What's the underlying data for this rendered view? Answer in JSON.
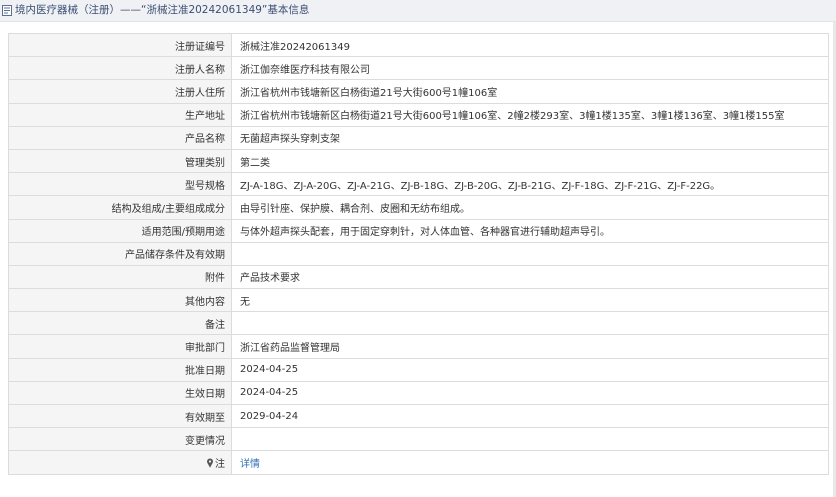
{
  "header": {
    "icon": "document-icon",
    "title": "境内医疗器械（注册）——“浙械注准20242061349”基本信息"
  },
  "rows": [
    {
      "label": "注册证编号",
      "value": "浙械注准20242061349"
    },
    {
      "label": "注册人名称",
      "value": "浙江伽奈维医疗科技有限公司"
    },
    {
      "label": "注册人住所",
      "value": "浙江省杭州市钱塘新区白杨街道21号大街600号1幢106室"
    },
    {
      "label": "生产地址",
      "value": "浙江省杭州市钱塘新区白杨街道21号大街600号1幢106室、2幢2楼293室、3幢1楼135室、3幢1楼136室、3幢1楼155室"
    },
    {
      "label": "产品名称",
      "value": "无菌超声探头穿刺支架"
    },
    {
      "label": "管理类别",
      "value": "第二类"
    },
    {
      "label": "型号规格",
      "value": "ZJ-A-18G、ZJ-A-20G、ZJ-A-21G、ZJ-B-18G、ZJ-B-20G、ZJ-B-21G、ZJ-F-18G、ZJ-F-21G、ZJ-F-22G。"
    },
    {
      "label": "结构及组成/主要组成成分",
      "value": "由导引针座、保护膜、耦合剂、皮圈和无纺布组成。"
    },
    {
      "label": "适用范围/预期用途",
      "value": "与体外超声探头配套，用于固定穿刺针，对人体血管、各种器官进行辅助超声导引。"
    },
    {
      "label": "产品储存条件及有效期",
      "value": ""
    },
    {
      "label": "附件",
      "value": "产品技术要求"
    },
    {
      "label": "其他内容",
      "value": "无"
    },
    {
      "label": "备注",
      "value": ""
    },
    {
      "label": "审批部门",
      "value": "浙江省药品监督管理局"
    },
    {
      "label": "批准日期",
      "value": "2024-04-25"
    },
    {
      "label": "生效日期",
      "value": "2024-04-25"
    },
    {
      "label": "有效期至",
      "value": "2029-04-24"
    },
    {
      "label": "变更情况",
      "value": ""
    }
  ],
  "note_row": {
    "icon": "pin-icon",
    "label": "注",
    "link": "详情"
  },
  "colors": {
    "header_bg": "#f0f1f4",
    "header_text": "#3a4f72",
    "label_bg": "#f5f5f5",
    "border": "#dcdcdc",
    "link": "#2f6fb5"
  }
}
